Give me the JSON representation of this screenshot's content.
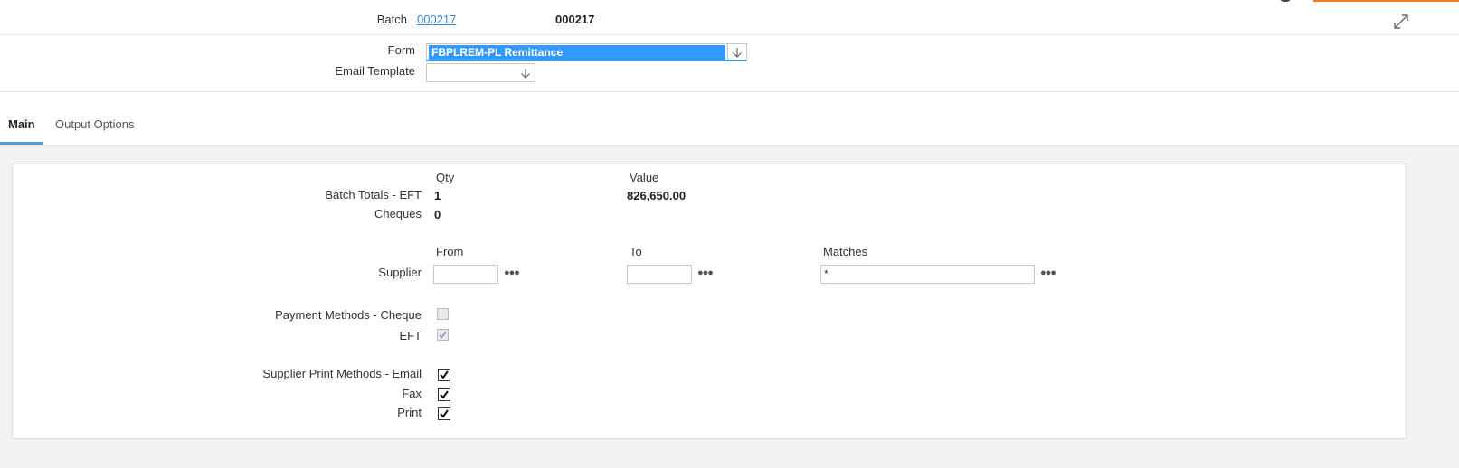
{
  "header": {
    "batch_label": "Batch",
    "batch_link": "000217",
    "batch_value": "000217",
    "form_label": "Form",
    "form_value": "FBPLREM-PL Remittance",
    "email_template_label": "Email Template",
    "email_template_value": ""
  },
  "tabs": [
    {
      "label": "Main",
      "active": true
    },
    {
      "label": "Output Options",
      "active": false
    }
  ],
  "totals": {
    "qty_header": "Qty",
    "value_header": "Value",
    "eft_label": "Batch Totals - EFT",
    "eft_qty": "1",
    "eft_value": "826,650.00",
    "cheques_label": "Cheques",
    "cheques_qty": "0"
  },
  "supplier": {
    "from_header": "From",
    "to_header": "To",
    "matches_header": "Matches",
    "label": "Supplier",
    "from_value": "",
    "to_value": "",
    "matches_value": "*",
    "lookup_icon": "ellipsis-icon"
  },
  "payment_methods": {
    "cheque_label": "Payment Methods - Cheque",
    "cheque_checked": false,
    "eft_label": "EFT",
    "eft_checked": true
  },
  "print_methods": {
    "email_label": "Supplier Print Methods - Email",
    "email_checked": true,
    "fax_label": "Fax",
    "fax_checked": true,
    "print_label": "Print",
    "print_checked": true
  },
  "colors": {
    "accent": "#4a9fd8",
    "selection": "#3399ff",
    "link": "#3a87c8",
    "orange": "#f07c22"
  }
}
